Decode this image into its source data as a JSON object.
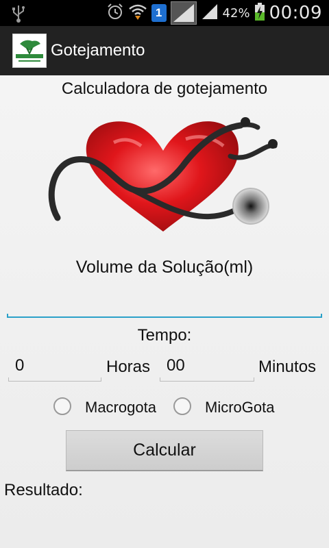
{
  "status_bar": {
    "battery_text": "42%",
    "time": "00:09",
    "sim_badge": "1",
    "icons": [
      "usb-icon",
      "alarm-icon",
      "wifi-icon",
      "sim-badge",
      "signal-box-icon",
      "signal-icon",
      "battery-charging-icon"
    ]
  },
  "action_bar": {
    "title": "Gotejamento",
    "logo_icon": "app-logo-icon"
  },
  "main": {
    "title": "Calculadora de gotejamento",
    "image": "heart-stethoscope-image",
    "volume_label": "Volume da Solução(ml)",
    "volume_value": "",
    "tempo_label": "Tempo:",
    "horas_value": "0",
    "horas_label": "Horas",
    "minutos_value": "00",
    "minutos_label": "Minutos",
    "radio_options": [
      {
        "label": "Macrogota",
        "checked": false
      },
      {
        "label": "MicroGota",
        "checked": false
      }
    ],
    "calculate_button": "Calcular",
    "result_label": "Resultado:"
  },
  "colors": {
    "input_focus": "#2aa0c8",
    "action_bar": "#222222",
    "status_bar": "#000000",
    "background": "#f2f2f2"
  }
}
